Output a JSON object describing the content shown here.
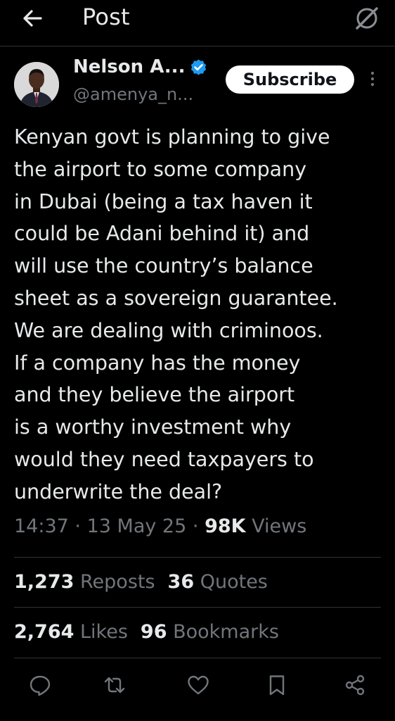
{
  "header": {
    "title": "Post",
    "back_icon": "arrow-left-icon",
    "grok_icon": "grok-icon"
  },
  "author": {
    "display_name": "Nelson A...",
    "handle": "@amenya_n...",
    "verified": true,
    "verified_color": "#1d9bf0"
  },
  "subscribe_label": "Subscribe",
  "tweet": {
    "lines": [
      "Kenyan govt is planning to give",
      "the airport to some company",
      "in Dubai (being a tax haven it",
      "could be Adani behind it) and",
      "will use the country’s balance",
      "sheet as a sovereign guarantee.",
      "We are dealing with criminoos.",
      "If a company has the money",
      "and they believe the airport",
      "is a worthy investment why",
      "would they need taxpayers to",
      "underwrite the deal?"
    ]
  },
  "meta": {
    "time": "14:37",
    "date": "13 May 25",
    "views_count": "98K",
    "views_label": "Views",
    "separator": "·"
  },
  "stats": {
    "reposts_count": "1,273",
    "reposts_label": "Reposts",
    "quotes_count": "36",
    "quotes_label": "Quotes",
    "likes_count": "2,764",
    "likes_label": "Likes",
    "bookmarks_count": "96",
    "bookmarks_label": "Bookmarks"
  },
  "actions": [
    "reply-icon",
    "repost-icon",
    "like-icon",
    "bookmark-icon",
    "share-icon"
  ],
  "colors": {
    "background": "#000000",
    "text": "#e7e9ea",
    "secondary": "#71767b",
    "divider": "#2f3336",
    "accent": "#1d9bf0"
  }
}
